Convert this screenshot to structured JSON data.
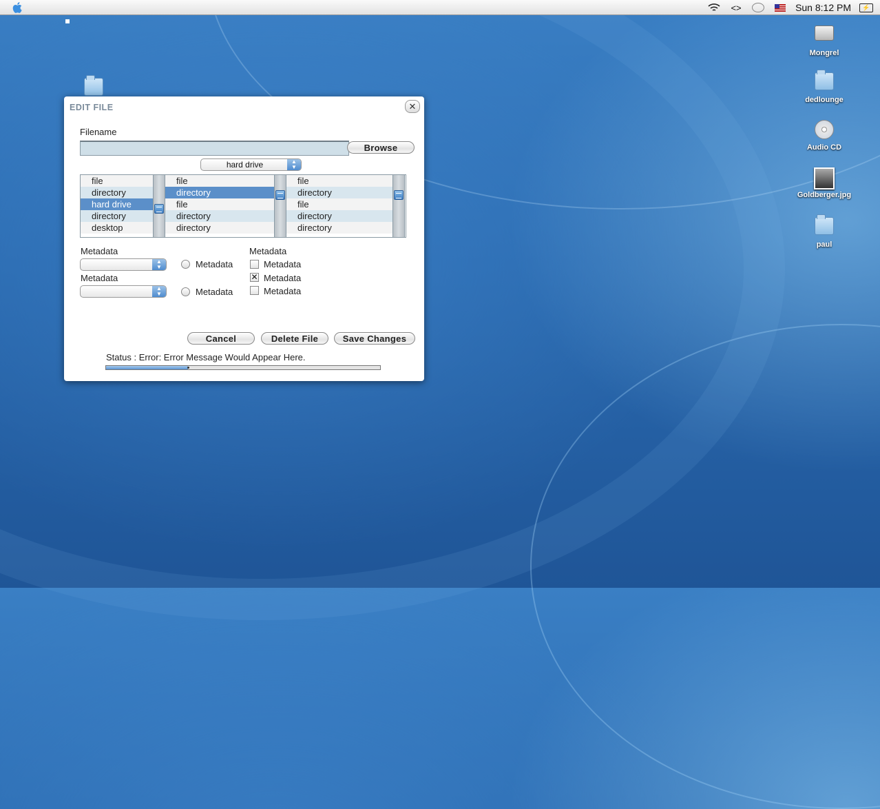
{
  "menubar": {
    "clock": "Sun 8:12 PM",
    "icons": [
      "apple-icon",
      "wifi-icon",
      "code-icon",
      "speech-bubble-icon",
      "flag-icon",
      "battery-icon"
    ]
  },
  "desktop": {
    "icons": [
      {
        "label": "Mongrel",
        "kind": "hard-disk-icon"
      },
      {
        "label": "dedlounge",
        "kind": "folder-icon"
      },
      {
        "label": "Audio CD",
        "kind": "cd-icon"
      },
      {
        "label": "Goldberger.jpg",
        "kind": "image-file-icon"
      },
      {
        "label": "paul",
        "kind": "folder-icon"
      }
    ]
  },
  "dialog": {
    "title": "EDIT FILE",
    "close_glyph": "✕",
    "filename_label": "Filename",
    "filename_value": "",
    "browse_label": "Browse",
    "location_popup": "hard drive",
    "columns": [
      {
        "items": [
          "file",
          "directory",
          "hard drive",
          "directory",
          "desktop"
        ],
        "selected": 2
      },
      {
        "items": [
          "file",
          "directory",
          "file",
          "directory",
          "directory"
        ],
        "selected": 1
      },
      {
        "items": [
          "file",
          "directory",
          "file",
          "directory",
          "directory"
        ],
        "selected": -1
      }
    ],
    "metadata": {
      "select1_label": "Metadata",
      "select1_value": "",
      "select2_label": "Metadata",
      "select2_value": "",
      "radio1_label": "Metadata",
      "radio2_label": "Metadata",
      "checkbox_group_label": "Metadata",
      "checkboxes": [
        {
          "label": "Metadata",
          "checked": false
        },
        {
          "label": "Metadata",
          "checked": true
        },
        {
          "label": "Metadata",
          "checked": false
        }
      ]
    },
    "buttons": {
      "cancel": "Cancel",
      "delete": "Delete File",
      "save": "Save Changes"
    },
    "status_text": "Status : Error: Error Message Would Appear Here.",
    "progress_fraction": 0.3
  },
  "colors": {
    "selection": "#5b8fc9",
    "row_alt": "#d8e6ee",
    "desktop": "#2a6ab0"
  }
}
